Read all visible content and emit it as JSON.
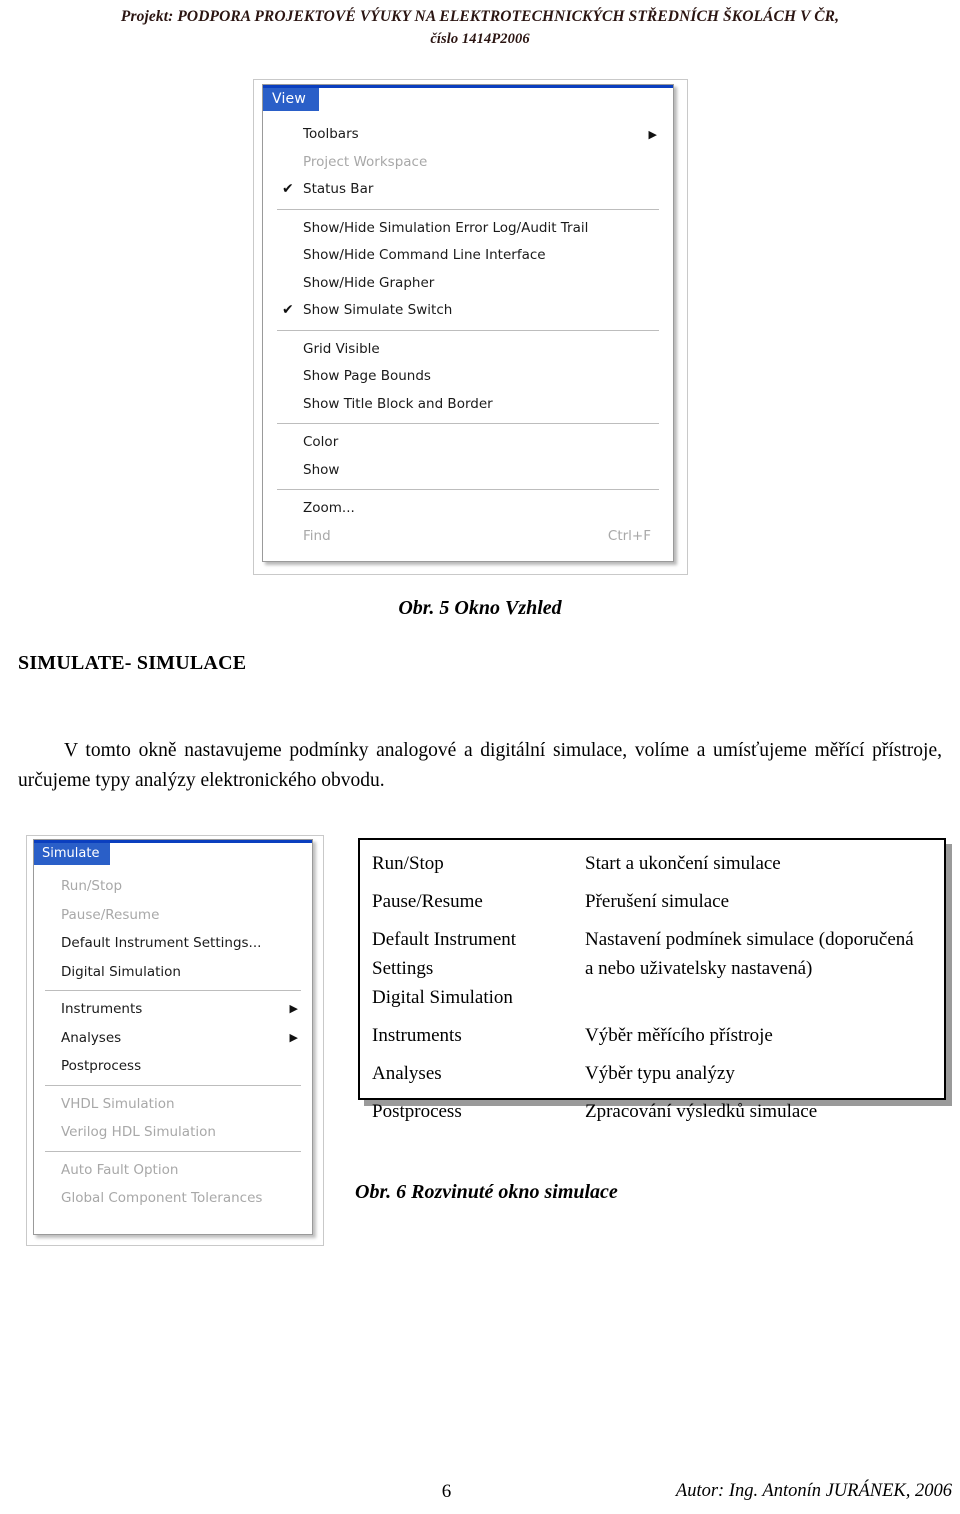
{
  "header": {
    "line1": "Projekt: PODPORA PROJEKTOVÉ VÝUKY NA ELEKTROTECHNICKÝCH STŘEDNÍCH ŠKOLÁCH V ČR,",
    "line2": "číslo 1414P2006"
  },
  "view_menu": {
    "title": "View",
    "groups": [
      {
        "items": [
          {
            "label": "Toolbars",
            "disabled": false,
            "checked": false,
            "submenu": true,
            "accel": ""
          },
          {
            "label": "Project Workspace",
            "disabled": true,
            "checked": false,
            "submenu": false,
            "accel": ""
          },
          {
            "label": "Status Bar",
            "disabled": false,
            "checked": true,
            "submenu": false,
            "accel": ""
          }
        ]
      },
      {
        "items": [
          {
            "label": "Show/Hide Simulation Error Log/Audit Trail",
            "disabled": false,
            "checked": false,
            "submenu": false,
            "accel": ""
          },
          {
            "label": "Show/Hide Command Line Interface",
            "disabled": false,
            "checked": false,
            "submenu": false,
            "accel": ""
          },
          {
            "label": "Show/Hide Grapher",
            "disabled": false,
            "checked": false,
            "submenu": false,
            "accel": ""
          },
          {
            "label": "Show Simulate Switch",
            "disabled": false,
            "checked": true,
            "submenu": false,
            "accel": ""
          }
        ]
      },
      {
        "items": [
          {
            "label": "Grid Visible",
            "disabled": false,
            "checked": false,
            "submenu": false,
            "accel": ""
          },
          {
            "label": "Show Page Bounds",
            "disabled": false,
            "checked": false,
            "submenu": false,
            "accel": ""
          },
          {
            "label": "Show Title Block and Border",
            "disabled": false,
            "checked": false,
            "submenu": false,
            "accel": ""
          }
        ]
      },
      {
        "items": [
          {
            "label": "Color",
            "disabled": false,
            "checked": false,
            "submenu": false,
            "accel": ""
          },
          {
            "label": "Show",
            "disabled": false,
            "checked": false,
            "submenu": false,
            "accel": ""
          }
        ]
      },
      {
        "items": [
          {
            "label": "Zoom...",
            "disabled": false,
            "checked": false,
            "submenu": false,
            "accel": ""
          },
          {
            "label": "Find",
            "disabled": true,
            "checked": false,
            "submenu": false,
            "accel": "Ctrl+F"
          }
        ]
      }
    ]
  },
  "figure5_caption": "Obr. 5 Okno Vzhled",
  "section": {
    "heading": "SIMULATE- SIMULACE",
    "paragraph": "V tomto okně nastavujeme podmínky analogové a digitální simulace, volíme a umísťujeme měřící přístroje, určujeme typy analýzy elektronického obvodu."
  },
  "simulate_menu": {
    "title": "Simulate",
    "groups": [
      {
        "items": [
          {
            "label": "Run/Stop",
            "disabled": true,
            "submenu": false
          },
          {
            "label": "Pause/Resume",
            "disabled": true,
            "submenu": false
          },
          {
            "label": "Default Instrument Settings...",
            "disabled": false,
            "submenu": false
          },
          {
            "label": "Digital Simulation",
            "disabled": false,
            "submenu": false
          }
        ]
      },
      {
        "items": [
          {
            "label": "Instruments",
            "disabled": false,
            "submenu": true
          },
          {
            "label": "Analyses",
            "disabled": false,
            "submenu": true
          },
          {
            "label": "Postprocess",
            "disabled": false,
            "submenu": false
          }
        ]
      },
      {
        "items": [
          {
            "label": "VHDL Simulation",
            "disabled": true,
            "submenu": false
          },
          {
            "label": "Verilog HDL Simulation",
            "disabled": true,
            "submenu": false
          }
        ]
      },
      {
        "items": [
          {
            "label": "Auto Fault Option",
            "disabled": true,
            "submenu": false
          },
          {
            "label": "Global Component Tolerances",
            "disabled": true,
            "submenu": false
          }
        ]
      }
    ]
  },
  "desc_table": {
    "rows": [
      {
        "term": "Run/Stop",
        "desc": "Start a ukončení simulace"
      },
      {
        "term": "Pause/Resume",
        "desc": "Přerušení simulace"
      },
      {
        "term": "Default Instrument",
        "desc": "Nastavení podmínek simulace (doporučená"
      },
      {
        "term": "Settings",
        "desc": "a nebo uživatelsky nastavená)"
      },
      {
        "term": "Digital Simulation",
        "desc": ""
      },
      {
        "term": "Instruments",
        "desc": "Výběr měřícího přístroje"
      },
      {
        "term": "Analyses",
        "desc": "Výběr typu analýzy"
      },
      {
        "term": "Postprocess",
        "desc": "Zpracování výsledků simulace"
      }
    ]
  },
  "figure6_caption": "Obr. 6 Rozvinuté okno simulace",
  "footer": {
    "page_number": "6",
    "author": "Autor: Ing. Antonín JURÁNEK, 2006"
  },
  "icons": {
    "check": "✔",
    "submenu_arrow": "▶"
  }
}
